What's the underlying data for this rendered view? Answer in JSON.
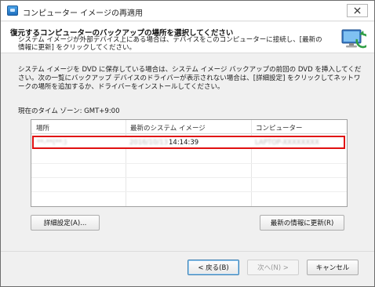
{
  "window": {
    "title": "コンピューター イメージの再適用",
    "close_symbol": "✕"
  },
  "header": {
    "title": "復元するコンピューターのバックアップの場所を選択してください",
    "subtitle": "システム イメージが外部デバイス上にある場合は、デバイスをこのコンピューターに接続し、[最新の情報に更新] をクリックしてください。"
  },
  "body": {
    "instructions": "システム イメージを DVD に保存している場合は、システム イメージ バックアップの前回の DVD を挿入してください。次の一覧にバックアップ デバイスのドライバーが表示されない場合は、[詳細設定] をクリックしてネットワークの場所を追加するか、ドライバーをインストールしてください。",
    "timezone": "現在のタイム ゾーン: GMT+9:00"
  },
  "table": {
    "columns": [
      "場所",
      "最新のシステム イメージ",
      "コンピューター"
    ],
    "rows": [
      {
        "location": "**-**(**:)",
        "date": "2016/10/13",
        "time": "14:14:39",
        "computer": "LAPTOP-XXXXXXXX"
      }
    ]
  },
  "buttons": {
    "advanced": "詳細設定(A)...",
    "refresh": "最新の情報に更新(R)",
    "back": "< 戻る(B)",
    "next": "次へ(N) >",
    "cancel": "キャンセル"
  }
}
